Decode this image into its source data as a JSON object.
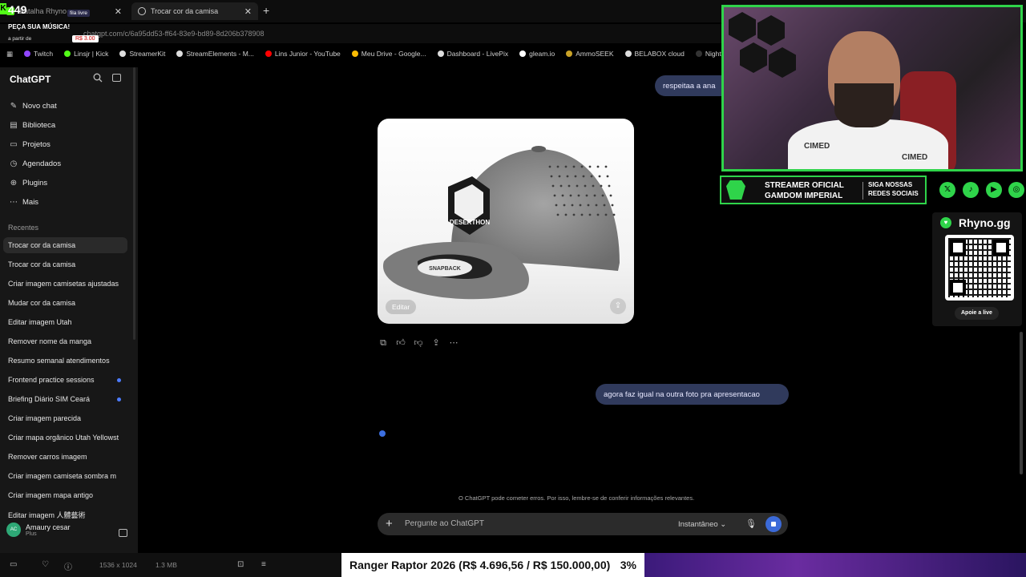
{
  "browser": {
    "tabs": [
      {
        "title": "Batalha Rhyno",
        "active": false
      },
      {
        "title": "Trocar cor da camisa",
        "active": true
      }
    ],
    "url": "chatgpt.com/c/6a95dd53-ff64-83e9-bd89-8d206b378908",
    "bookmarks": [
      {
        "label": "Twitch",
        "color": "#9146ff"
      },
      {
        "label": "Linsjr | Kick",
        "color": "#53fc18"
      },
      {
        "label": "StreamerKit",
        "color": "#dddddd"
      },
      {
        "label": "StreamElements - M...",
        "color": "#dddddd"
      },
      {
        "label": "Lins Junior - YouTube",
        "color": "#ff0000"
      },
      {
        "label": "Meu Drive - Google...",
        "color": "#fbbc04"
      },
      {
        "label": "Dashboard - LivePix",
        "color": "#dddddd"
      },
      {
        "label": "gleam.io",
        "color": "#ffffff"
      },
      {
        "label": "AmmoSEEK",
        "color": "#c9a227"
      },
      {
        "label": "BELABOX cloud",
        "color": "#dddddd"
      },
      {
        "label": "Nightbot - Comm...",
        "color": "#333333"
      }
    ]
  },
  "stream_overlay": {
    "count": "449",
    "fila": "fila livre",
    "peca": "PEÇA SUA MÚSICA!",
    "a_partir": "a partir de",
    "price": "R$ 3.00"
  },
  "sidebar": {
    "title": "ChatGPT",
    "nav": [
      {
        "label": "Novo chat",
        "icon": "edit-icon"
      },
      {
        "label": "Biblioteca",
        "icon": "library-icon"
      },
      {
        "label": "Projetos",
        "icon": "folder-icon"
      },
      {
        "label": "Agendados",
        "icon": "clock-icon"
      },
      {
        "label": "Plugins",
        "icon": "plugins-icon"
      },
      {
        "label": "Mais",
        "icon": "more-icon"
      }
    ],
    "recent_heading": "Recentes",
    "recents": [
      {
        "label": "Trocar cor da camisa",
        "active": true,
        "dot": false
      },
      {
        "label": "Trocar cor da camisa",
        "active": false,
        "dot": false
      },
      {
        "label": "Criar imagem camisetas ajustadas",
        "active": false,
        "dot": false
      },
      {
        "label": "Mudar cor da camisa",
        "active": false,
        "dot": false
      },
      {
        "label": "Editar imagem Utah",
        "active": false,
        "dot": false
      },
      {
        "label": "Remover nome da manga",
        "active": false,
        "dot": false
      },
      {
        "label": "Resumo semanal atendimentos",
        "active": false,
        "dot": false
      },
      {
        "label": "Frontend practice sessions",
        "active": false,
        "dot": true
      },
      {
        "label": "Briefing Diário SIM Ceará",
        "active": false,
        "dot": true
      },
      {
        "label": "Criar imagem parecida",
        "active": false,
        "dot": false
      },
      {
        "label": "Criar mapa orgânico Utah Yellowst",
        "active": false,
        "dot": false
      },
      {
        "label": "Remover carros imagem",
        "active": false,
        "dot": false
      },
      {
        "label": "Criar imagem camiseta sombra m",
        "active": false,
        "dot": false
      },
      {
        "label": "Criar imagem mapa antigo",
        "active": false,
        "dot": false
      },
      {
        "label": "Editar imagem 人體藝術",
        "active": false,
        "dot": false
      }
    ],
    "user": {
      "name": "Amaury cesar",
      "plan": "Plus",
      "initials": "AC"
    }
  },
  "chat": {
    "message_1": "respeitaa a ana",
    "image": {
      "edit_label": "Editar",
      "patch_text": "DESERTHON",
      "snap_text": "SNAPBACK"
    },
    "message_2": "agora faz igual na outra foto pra apresentacao",
    "disclaimer": "O ChatGPT pode cometer erros. Por isso, lembre-se de conferir informações relevantes.",
    "composer": {
      "placeholder": "Pergunte ao ChatGPT",
      "mode": "Instantâneo"
    }
  },
  "webcam": {
    "banner_line1": "STREAMER OFICIAL",
    "banner_line2": "GAMDOM IMPERIAL",
    "banner_right1": "SIGA NOSSAS",
    "banner_right2": "REDES SOCIAIS",
    "cimed": "CIMED",
    "rhyno": "Rhyno.gg",
    "apoie": "Apoie a live"
  },
  "bottom": {
    "dims": "1536 x 1024",
    "size": "1.3 MB",
    "goal_text": "Ranger Raptor 2026 (R$ 4.696,56 / R$ 150.000,00)",
    "goal_pct": "3%",
    "goal_progress": 0.03
  }
}
